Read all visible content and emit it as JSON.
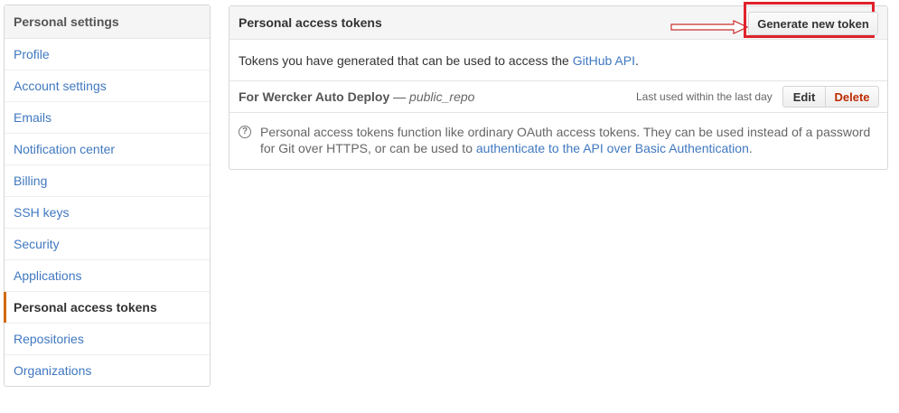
{
  "sidebar": {
    "title": "Personal settings",
    "items": [
      {
        "label": "Profile"
      },
      {
        "label": "Account settings"
      },
      {
        "label": "Emails"
      },
      {
        "label": "Notification center"
      },
      {
        "label": "Billing"
      },
      {
        "label": "SSH keys"
      },
      {
        "label": "Security"
      },
      {
        "label": "Applications"
      },
      {
        "label": "Personal access tokens",
        "selected": true
      },
      {
        "label": "Repositories"
      },
      {
        "label": "Organizations"
      }
    ]
  },
  "panel": {
    "title": "Personal access tokens",
    "generate_label": "Generate new token",
    "intro_prefix": "Tokens you have generated that can be used to access the ",
    "intro_link": "GitHub API",
    "intro_suffix": ".",
    "token": {
      "name": "For Wercker Auto Deploy",
      "dash": " — ",
      "scope": "public_repo",
      "last_used": "Last used within the last day",
      "edit_label": "Edit",
      "delete_label": "Delete"
    },
    "help": {
      "icon_glyph": "?",
      "text_prefix": "Personal access tokens function like ordinary OAuth access tokens. They can be used instead of a password for Git over HTTPS, or can be used to ",
      "link": "authenticate to the API over Basic Authentication",
      "text_suffix": "."
    }
  },
  "colors": {
    "link": "#4078c0",
    "selected_accent": "#d26911",
    "highlight_red": "#e0222b",
    "delete_red": "#bd2c00"
  },
  "icons": {
    "help": "question-circle-icon",
    "arrow": "arrow-right-annotation-icon"
  }
}
